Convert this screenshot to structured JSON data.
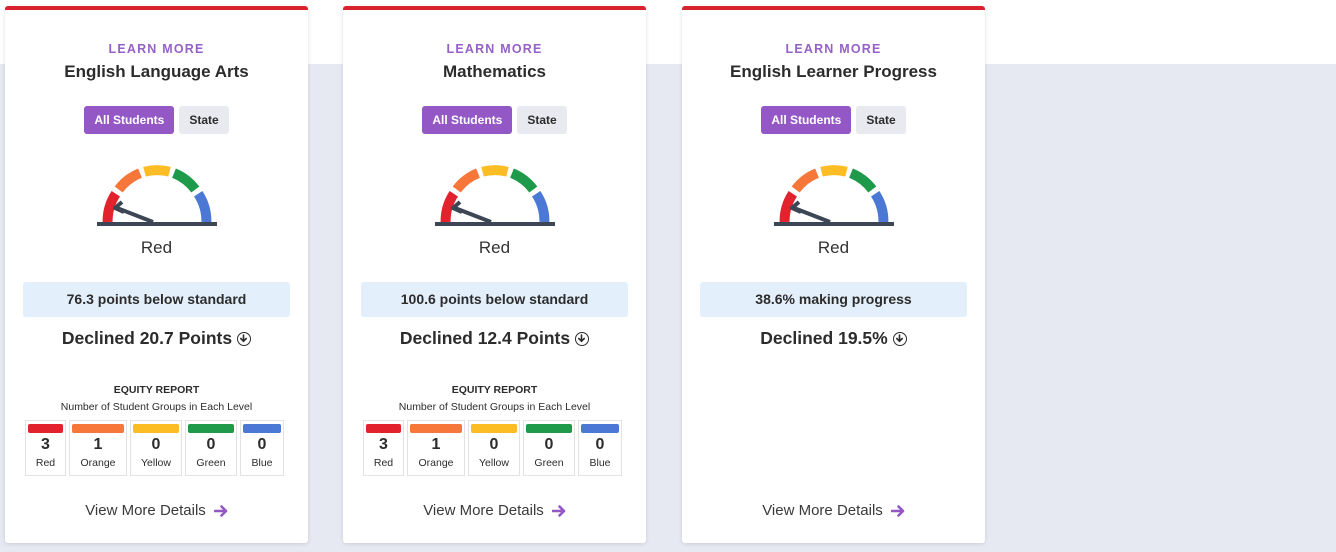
{
  "colors": {
    "red": "#e2232e",
    "orange": "#f7773a",
    "yellow": "#fbbc24",
    "green": "#1e9a4a",
    "blue": "#4a78d4",
    "accent": "#9358c6",
    "card_top": "#d8232e"
  },
  "cards": [
    {
      "learn_more": "LEARN MORE",
      "title": "English Language Arts",
      "toggle_all": "All Students",
      "toggle_state": "State",
      "gauge_level": "Red",
      "status": "76.3 points below standard",
      "change": "Declined 20.7 Points",
      "change_icon": "arrow-circle-down-icon",
      "equity": {
        "title": "EQUITY REPORT",
        "subtitle": "Number of Student Groups in Each Level",
        "levels": [
          {
            "count": "3",
            "name": "Red"
          },
          {
            "count": "1",
            "name": "Orange"
          },
          {
            "count": "0",
            "name": "Yellow"
          },
          {
            "count": "0",
            "name": "Green"
          },
          {
            "count": "0",
            "name": "Blue"
          }
        ]
      },
      "view_more": "View More Details"
    },
    {
      "learn_more": "LEARN MORE",
      "title": "Mathematics",
      "toggle_all": "All Students",
      "toggle_state": "State",
      "gauge_level": "Red",
      "status": "100.6 points below standard",
      "change": "Declined 12.4 Points",
      "change_icon": "arrow-circle-down-icon",
      "equity": {
        "title": "EQUITY REPORT",
        "subtitle": "Number of Student Groups in Each Level",
        "levels": [
          {
            "count": "3",
            "name": "Red"
          },
          {
            "count": "1",
            "name": "Orange"
          },
          {
            "count": "0",
            "name": "Yellow"
          },
          {
            "count": "0",
            "name": "Green"
          },
          {
            "count": "0",
            "name": "Blue"
          }
        ]
      },
      "view_more": "View More Details"
    },
    {
      "learn_more": "LEARN MORE",
      "title": "English Learner Progress",
      "toggle_all": "All Students",
      "toggle_state": "State",
      "gauge_level": "Red",
      "status": "38.6% making progress",
      "change": "Declined 19.5%",
      "change_icon": "arrow-circle-down-icon",
      "view_more": "View More Details"
    }
  ]
}
